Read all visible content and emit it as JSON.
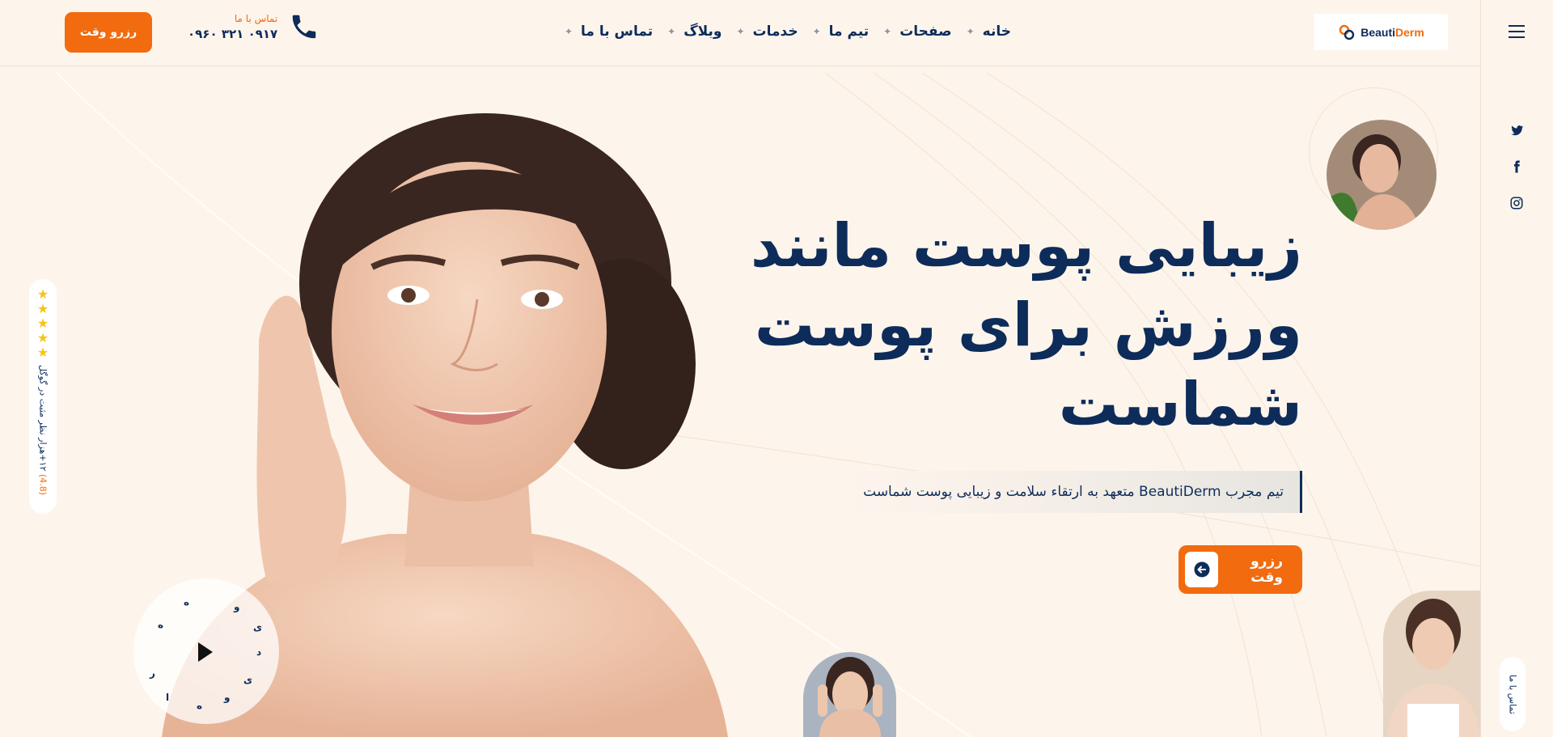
{
  "header": {
    "logo": {
      "part1": "Beauti",
      "part2": "Derm"
    },
    "nav": [
      {
        "label": "خانه"
      },
      {
        "label": "صفحات"
      },
      {
        "label": "تیم ما"
      },
      {
        "label": "خدمات"
      },
      {
        "label": "وبلاگ"
      },
      {
        "label": "تماس با ما"
      }
    ],
    "contact_label": "تماس با ما",
    "phone": "۰۹۱۷ ۳۲۱ ۰۹۶۰",
    "book_button": "رزرو وقت"
  },
  "hero": {
    "title_lines": [
      "زیبایی پوست مانند",
      "ورزش برای پوست",
      "شماست"
    ],
    "tagline": "تیم مجرب BeautiDerm متعهد به ارتقاء سلامت و زیبایی پوست شماست",
    "cta": "رزرو وقت"
  },
  "rating": {
    "stars": 5,
    "score": "(4.8)",
    "text": "۱۲+هزار نظر مثبت در گوگل"
  },
  "video": {
    "ring_letters": [
      "ه",
      "و",
      "ی",
      "د",
      "ی",
      "و",
      "ه",
      "ا",
      "ر",
      "ه"
    ]
  },
  "side": {
    "contact_pill": "تماس با ما",
    "socials": [
      "twitter-icon",
      "facebook-icon",
      "instagram-icon"
    ]
  },
  "colors": {
    "accent": "#f26b0f",
    "navy": "#0d2c5a",
    "background": "#fdf5ec"
  }
}
